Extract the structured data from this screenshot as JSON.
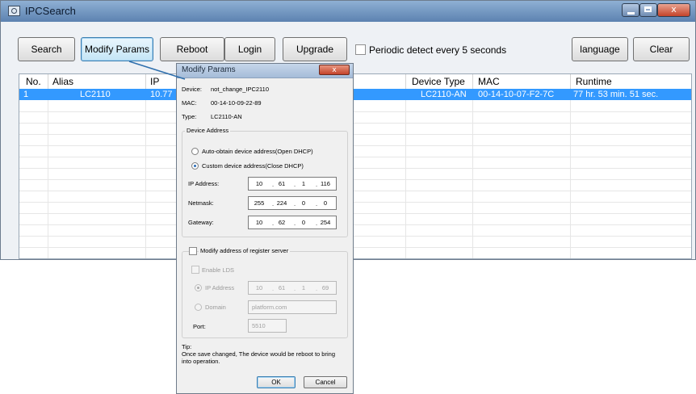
{
  "window": {
    "title": "IPCSearch",
    "controls": {
      "minimize": "▁",
      "maximize": "□",
      "close": "x"
    }
  },
  "toolbar": {
    "search_label": "Search",
    "modify_label": "Modify Params",
    "reboot_label": "Reboot",
    "login_label": "Login",
    "upgrade_label": "Upgrade",
    "periodic_label": "Periodic detect every 5 seconds",
    "language_label": "language",
    "clear_label": "Clear"
  },
  "grid": {
    "columns": [
      "No.",
      "Alias",
      "IP",
      "Device Type",
      "MAC",
      "Runtime"
    ],
    "rows": [
      {
        "no": "1",
        "alias": "LC2110",
        "ip": "10.77",
        "device_type": "LC2110-AN",
        "mac": "00-14-10-07-F2-7C",
        "runtime": "77 hr. 53 min. 51 sec."
      }
    ]
  },
  "dialog": {
    "title": "Modify Params",
    "close_label": "x",
    "device_label": "Device:",
    "device_value": "not_change_IPC2110",
    "mac_label": "MAC:",
    "mac_value": "00-14-10-09-22-89",
    "type_label": "Type:",
    "type_value": "LC2110-AN",
    "device_address": {
      "group_title": "Device Address",
      "auto_label": "Auto-obtain device address(Open DHCP)",
      "custom_label": "Custom device address(Close DHCP)",
      "ip_label": "IP Address:",
      "ip": [
        "10",
        "61",
        "1",
        "116"
      ],
      "netmask_label": "Netmask:",
      "netmask": [
        "255",
        "224",
        "0",
        "0"
      ],
      "gateway_label": "Gateway:",
      "gateway": [
        "10",
        "62",
        "0",
        "254"
      ]
    },
    "register_server": {
      "modify_label": "Modify address of register server",
      "enable_lds_label": "Enable LDS",
      "ip_label": "IP Address",
      "ip": [
        "10",
        "61",
        "1",
        "69"
      ],
      "domain_label": "Domain",
      "domain_value": "platform.com",
      "port_label": "Port:",
      "port_value": "5510"
    },
    "tip_label": "Tip:",
    "tip_line1": "Once save changed, The device would be reboot to bring",
    "tip_line2": "into operation.",
    "ok_label": "OK",
    "cancel_label": "Cancel"
  },
  "colors": {
    "selection": "#3399ff",
    "titlebar": "#5c82b0",
    "callout": "#2e6fad"
  }
}
